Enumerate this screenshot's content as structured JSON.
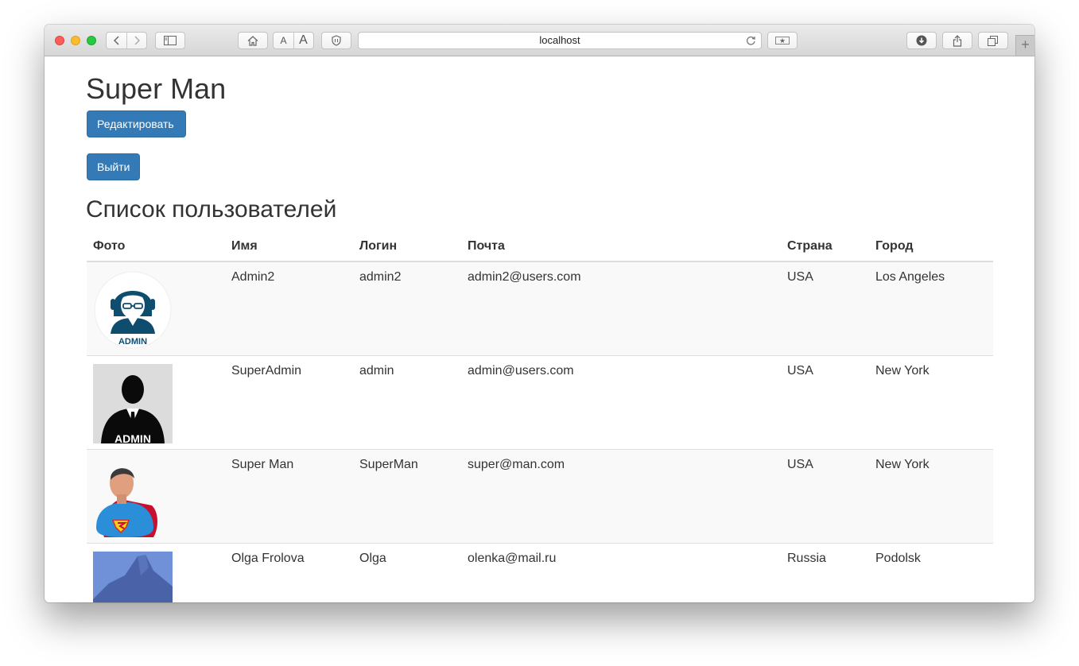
{
  "browser": {
    "url": "localhost"
  },
  "page": {
    "title": "Super Man",
    "edit_button": "Редактировать",
    "logout_button": "Выйти",
    "list_title": "Список пользователей"
  },
  "table": {
    "headers": [
      "Фото",
      "Имя",
      "Логин",
      "Почта",
      "Страна",
      "Город"
    ],
    "rows": [
      {
        "photo": "admin-headset-avatar",
        "name": "Admin2",
        "login": "admin2",
        "email": "admin2@users.com",
        "country": "USA",
        "city": "Los Angeles"
      },
      {
        "photo": "admin-silhouette-avatar",
        "photo_caption": "ADMIN",
        "name": "SuperAdmin",
        "login": "admin",
        "email": "admin@users.com",
        "country": "USA",
        "city": "New York"
      },
      {
        "photo": "superman-avatar",
        "name": "Super Man",
        "login": "SuperMan",
        "email": "super@man.com",
        "country": "USA",
        "city": "New York"
      },
      {
        "photo": "mountain-photo",
        "name": "Olga Frolova",
        "login": "Olga",
        "email": "olenka@mail.ru",
        "country": "Russia",
        "city": "Podolsk"
      }
    ]
  },
  "colors": {
    "primary_button": "#337ab7",
    "text": "#333333",
    "row_stripe": "#f9f9f9"
  }
}
